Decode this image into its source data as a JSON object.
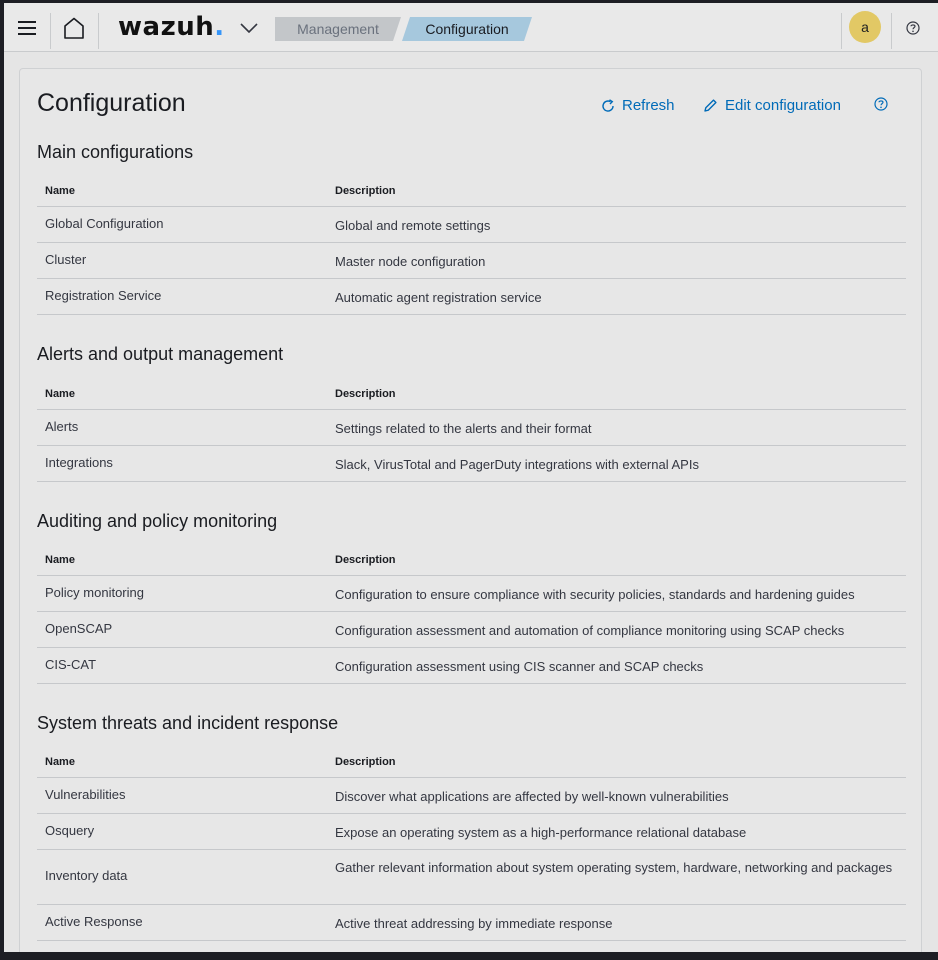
{
  "header": {
    "logo_text": "wazuh",
    "logo_dot": ".",
    "breadcrumbs": [
      "Management",
      "Configuration"
    ],
    "avatar_letter": "a"
  },
  "page": {
    "title": "Configuration",
    "refresh_label": "Refresh",
    "edit_label": "Edit configuration"
  },
  "table_headers": {
    "name": "Name",
    "description": "Description"
  },
  "sections": [
    {
      "title": "Main configurations",
      "rows": [
        {
          "name": "Global Configuration",
          "description": "Global and remote settings"
        },
        {
          "name": "Cluster",
          "description": "Master node configuration"
        },
        {
          "name": "Registration Service",
          "description": "Automatic agent registration service"
        }
      ]
    },
    {
      "title": "Alerts and output management",
      "rows": [
        {
          "name": "Alerts",
          "description": "Settings related to the alerts and their format"
        },
        {
          "name": "Integrations",
          "description": "Slack, VirusTotal and PagerDuty integrations with external APIs"
        }
      ]
    },
    {
      "title": "Auditing and policy monitoring",
      "rows": [
        {
          "name": "Policy monitoring",
          "description": "Configuration to ensure compliance with security policies, standards and hardening guides"
        },
        {
          "name": "OpenSCAP",
          "description": "Configuration assessment and automation of compliance monitoring using SCAP checks"
        },
        {
          "name": "CIS-CAT",
          "description": "Configuration assessment using CIS scanner and SCAP checks"
        }
      ]
    },
    {
      "title": "System threats and incident response",
      "rows": [
        {
          "name": "Vulnerabilities",
          "description": "Discover what applications are affected by well-known vulnerabilities"
        },
        {
          "name": "Osquery",
          "description": "Expose an operating system as a high-performance relational database"
        },
        {
          "name": "Inventory data",
          "description": "Gather relevant information about system operating system, hardware, networking and packages"
        },
        {
          "name": "Active Response",
          "description": "Active threat addressing by immediate response"
        }
      ]
    }
  ]
}
